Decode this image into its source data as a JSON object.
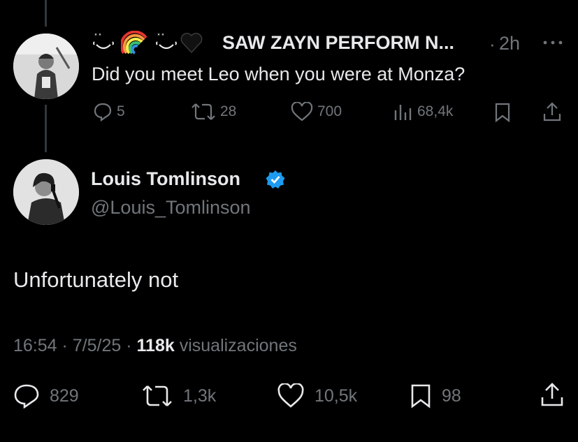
{
  "parent": {
    "name": "SAW ZAYN PERFORM N...",
    "dot": "·",
    "time": "2h",
    "text": "Did you meet Leo when you were at Monza?",
    "actions": {
      "replies": "5",
      "reposts": "28",
      "likes": "700",
      "views": "68,4k"
    }
  },
  "post": {
    "name": "Louis Tomlinson",
    "handle": "@Louis_Tomlinson",
    "text": "Unfortunately not",
    "meta_time": "16:54 · 7/5/25 · ",
    "meta_views": "118k",
    "meta_views_label": " visualizaciones",
    "actions": {
      "replies": "829",
      "reposts": "1,3k",
      "likes": "10,5k",
      "bookmarks": "98"
    }
  },
  "colors": {
    "background": "#000000",
    "text": "#e7e9ea",
    "muted": "#71767b",
    "verified": "#1d9bf0"
  }
}
